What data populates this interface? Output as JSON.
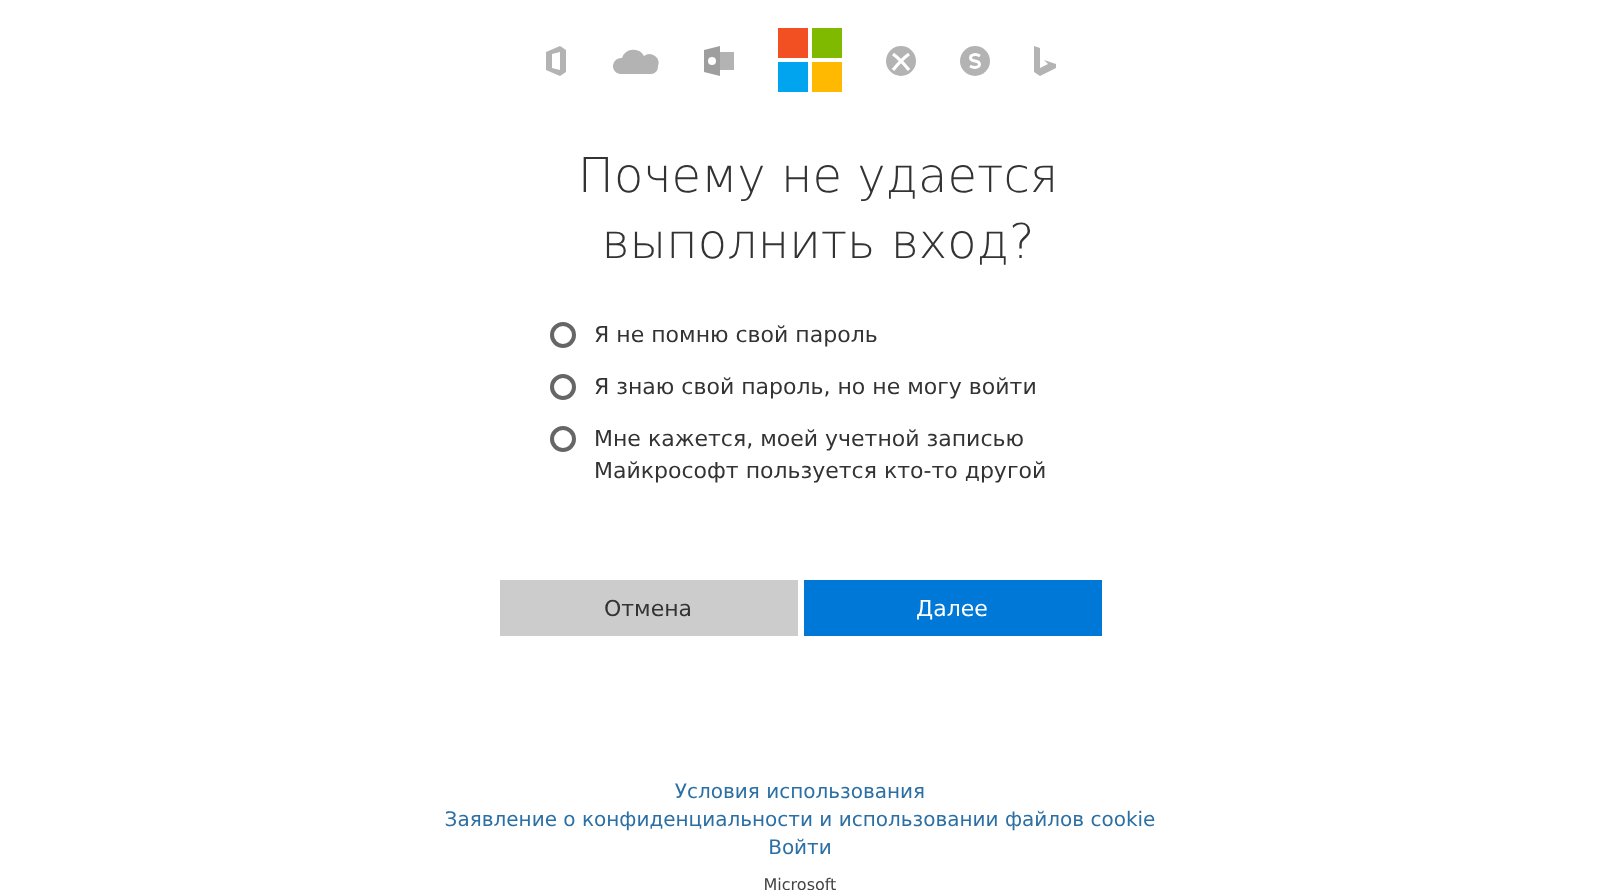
{
  "heading": "Почему не удается выполнить вход?",
  "options": [
    {
      "label": "Я не помню свой пароль",
      "selected": false
    },
    {
      "label": "Я знаю свой пароль, но не могу войти",
      "selected": false
    },
    {
      "label": "Мне кажется, моей учетной записью Майкрософт пользуется кто-то другой",
      "selected": false
    }
  ],
  "buttons": [
    {
      "label": "Отмена",
      "kind": "secondary"
    },
    {
      "label": "Далее",
      "kind": "primary"
    }
  ],
  "footer_links": [
    "Условия использования",
    "Заявление о конфиденциальности и использовании файлов cookie",
    "Войти"
  ],
  "footer_brand": "Microsoft"
}
